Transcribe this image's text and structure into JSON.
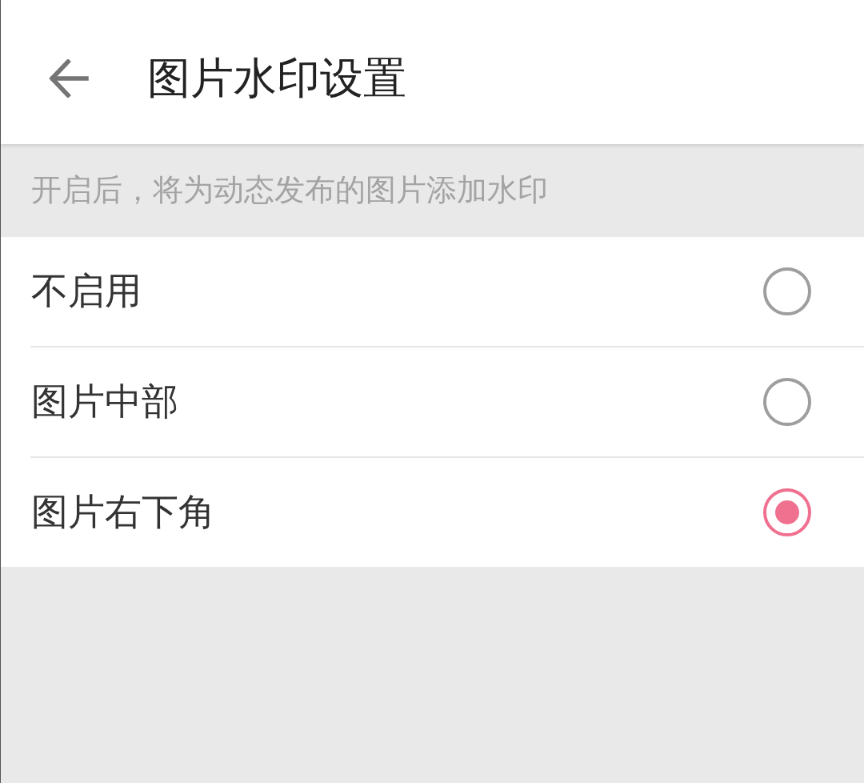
{
  "header": {
    "title": "图片水印设置"
  },
  "hint": "开启后，将为动态发布的图片添加水印",
  "options": [
    {
      "label": "不启用",
      "selected": false
    },
    {
      "label": "图片中部",
      "selected": false
    },
    {
      "label": "图片右下角",
      "selected": true
    }
  ]
}
